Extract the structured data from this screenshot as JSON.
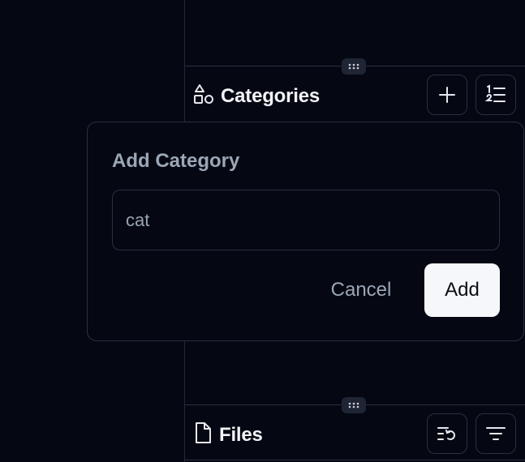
{
  "categories_section": {
    "title": "Categories",
    "icon": "shapes-icon",
    "add_button_icon": "plus-icon",
    "sort_button_icon": "numbered-list-icon"
  },
  "add_category_popover": {
    "title": "Add Category",
    "input_value": "cat",
    "cancel_label": "Cancel",
    "add_label": "Add"
  },
  "files_section": {
    "title": "Files",
    "icon": "file-icon",
    "history_button_icon": "list-rotate-icon",
    "filter_button_icon": "filter-lines-icon"
  },
  "colors": {
    "background": "#050812",
    "border": "#2a3042",
    "muted_text": "#9ba6b6",
    "primary_button": "#f6f7fa"
  }
}
